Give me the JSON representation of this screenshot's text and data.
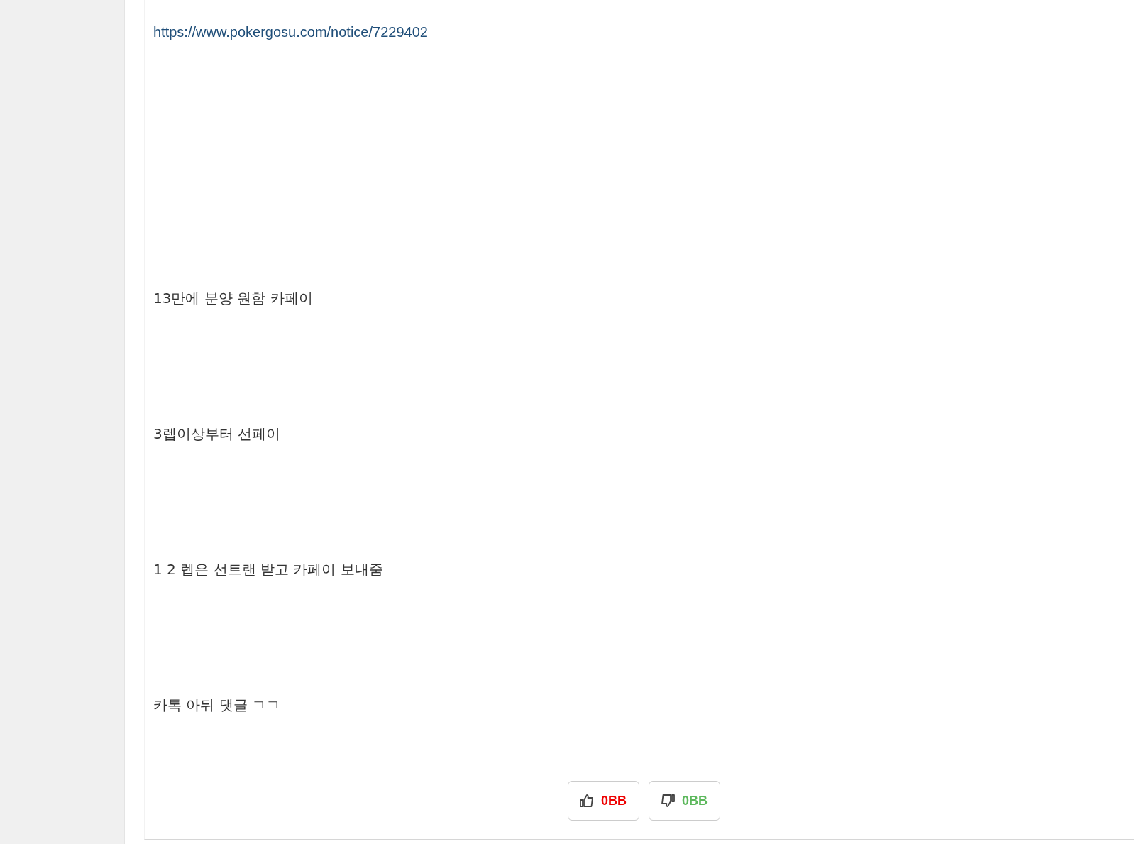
{
  "link": "https://www.pokergosu.com/notice/7229402",
  "paragraphs": [
    "13만에 분양 원함 카페이",
    "3렙이상부터 선페이",
    "1 2 렙은 선트랜 받고 카페이 보내줌",
    "카톡 아뒤 댓글 ㄱㄱ"
  ],
  "votes": [
    {
      "kind": "up",
      "label": "0BB",
      "color": "#ee0000"
    },
    {
      "kind": "down",
      "label": "0BB",
      "color": "#5cb85c"
    }
  ]
}
